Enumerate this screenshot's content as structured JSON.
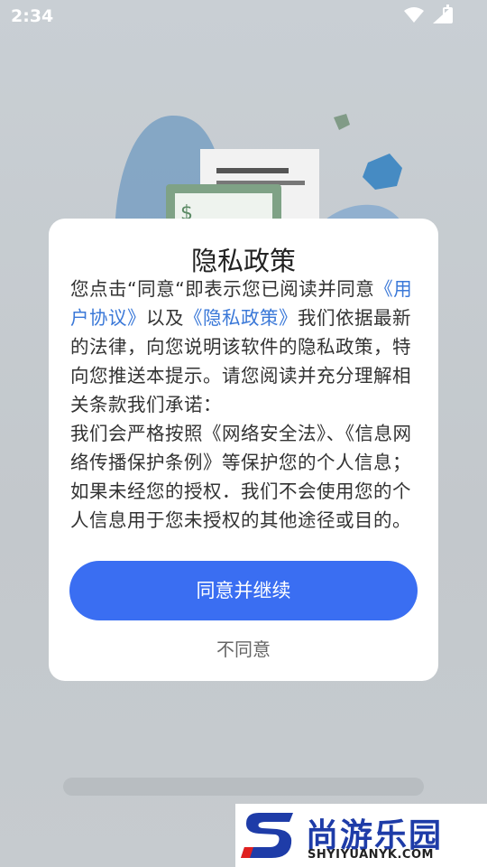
{
  "status_bar": {
    "time": "2:34"
  },
  "dialog": {
    "title": "隐私政策",
    "body": [
      {
        "text": "您点击“同意“即表示您已阅读并同意",
        "link": false
      },
      {
        "text": "《用户协议》",
        "link": true
      },
      {
        "text": "以及",
        "link": false
      },
      {
        "text": "《隐私政策》",
        "link": true
      },
      {
        "text": "我们依据最新的法律，向您说明该软件的隐私政策，特向您推送本提示。请您阅读并充分理解相关条款我们承诺：",
        "link": false
      },
      {
        "text": "我们会严格按照《网络安全法》、《信息网络传播保护条例》等保护您的个人信息；如果未经您的授权．我们不会使用您的个人信息用于您未授权的其他途径或目的。",
        "link": false
      }
    ],
    "agree_label": "同意并继续",
    "disagree_label": "不同意"
  },
  "watermark": {
    "name": "尚游乐园",
    "url": "SHYIYUANYK.COM"
  },
  "colors": {
    "primary": "#3a6ef2",
    "link": "#3a78d8"
  }
}
